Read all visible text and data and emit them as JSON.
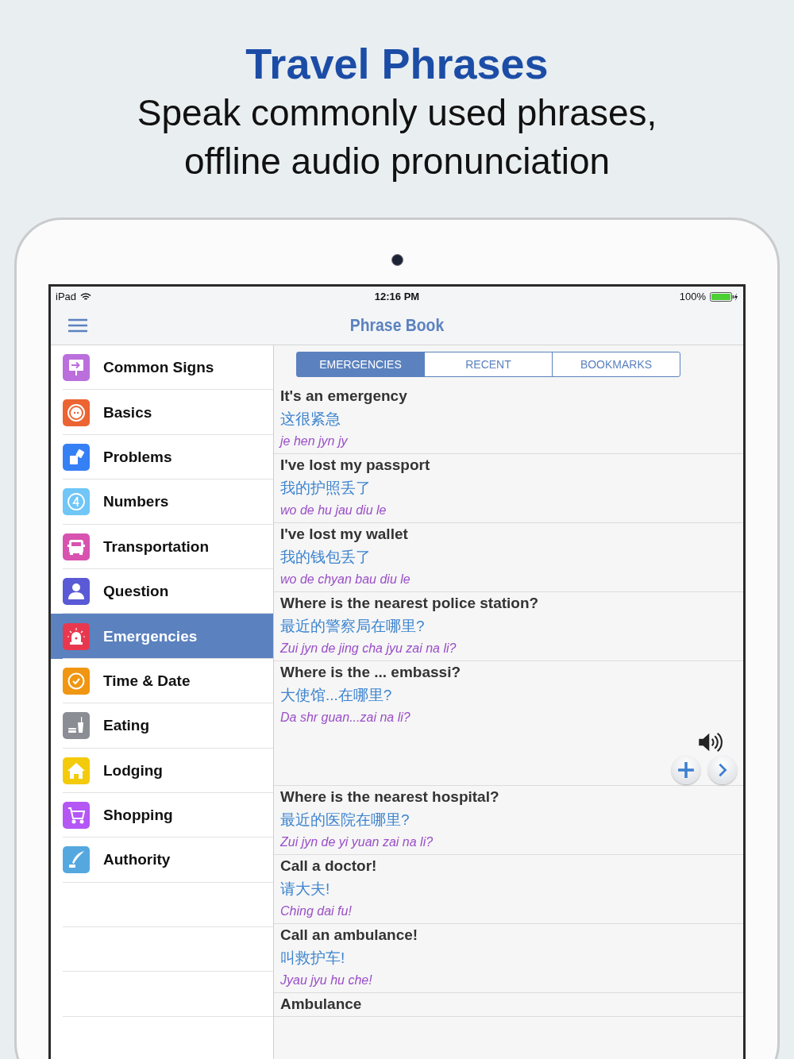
{
  "header": {
    "title": "Travel Phrases",
    "subtitle_lines": [
      "Speak commonly used phrases,",
      "offline audio pronunciation"
    ]
  },
  "status_bar": {
    "device": "iPad",
    "time": "12:16 PM",
    "battery": "100%"
  },
  "nav_bar": {
    "title": "Phrase Book"
  },
  "sidebar": {
    "items": [
      {
        "label": "Common Signs",
        "kind": "sign",
        "color": "#bb6fdc",
        "selected": false
      },
      {
        "label": "Basics",
        "kind": "face",
        "color": "#ec6431",
        "selected": false
      },
      {
        "label": "Problems",
        "kind": "lighter",
        "color": "#3580f5",
        "selected": false
      },
      {
        "label": "Numbers",
        "kind": "number",
        "color": "#6fc6f7",
        "selected": false
      },
      {
        "label": "Transportation",
        "kind": "bus",
        "color": "#d853b0",
        "selected": false
      },
      {
        "label": "Question",
        "kind": "person",
        "color": "#5a5ad6",
        "selected": false
      },
      {
        "label": "Emergencies",
        "kind": "siren",
        "color": "#e8384f",
        "selected": true
      },
      {
        "label": "Time & Date",
        "kind": "clock",
        "color": "#f09612",
        "selected": false
      },
      {
        "label": "Eating",
        "kind": "food",
        "color": "#8a8d93",
        "selected": false
      },
      {
        "label": "Lodging",
        "kind": "house",
        "color": "#f4cb0b",
        "selected": false
      },
      {
        "label": "Shopping",
        "kind": "cart",
        "color": "#b457f5",
        "selected": false
      },
      {
        "label": "Authority",
        "kind": "quill",
        "color": "#55a8df",
        "selected": false
      }
    ]
  },
  "tabs": [
    {
      "label": "EMERGENCIES",
      "selected": true
    },
    {
      "label": "RECENT",
      "selected": false
    },
    {
      "label": "BOOKMARKS",
      "selected": false
    }
  ],
  "phrases": [
    {
      "english": "It's an emergency",
      "chinese": "这很紧急",
      "pinyin": "je hen jyn jy",
      "expanded": false
    },
    {
      "english": "I've lost my passport",
      "chinese": "我的护照丢了",
      "pinyin": "wo de hu jau diu le",
      "expanded": false
    },
    {
      "english": "I've lost my wallet",
      "chinese": "我的钱包丢了",
      "pinyin": "wo de chyan  bau diu le",
      "expanded": false
    },
    {
      "english": "Where is the nearest police station?",
      "chinese": "最近的警察局在哪里?",
      "pinyin": "Zui jyn de jing cha jyu zai na li?",
      "expanded": false
    },
    {
      "english": "Where is the ... embassi?",
      "chinese": "大使馆...在哪里?",
      "pinyin": "Da shr guan...zai na li?",
      "expanded": true
    },
    {
      "english": "Where is the nearest hospital?",
      "chinese": "最近的医院在哪里?",
      "pinyin": "Zui jyn de yi  yuan zai na li?",
      "expanded": false
    },
    {
      "english": "Call a doctor!",
      "chinese": "请大夫!",
      "pinyin": "Ching dai fu!",
      "expanded": false
    },
    {
      "english": "Call an ambulance!",
      "chinese": "叫救护车!",
      "pinyin": "Jyau jyu hu che!",
      "expanded": false
    },
    {
      "english": "Ambulance",
      "expanded": false
    }
  ]
}
